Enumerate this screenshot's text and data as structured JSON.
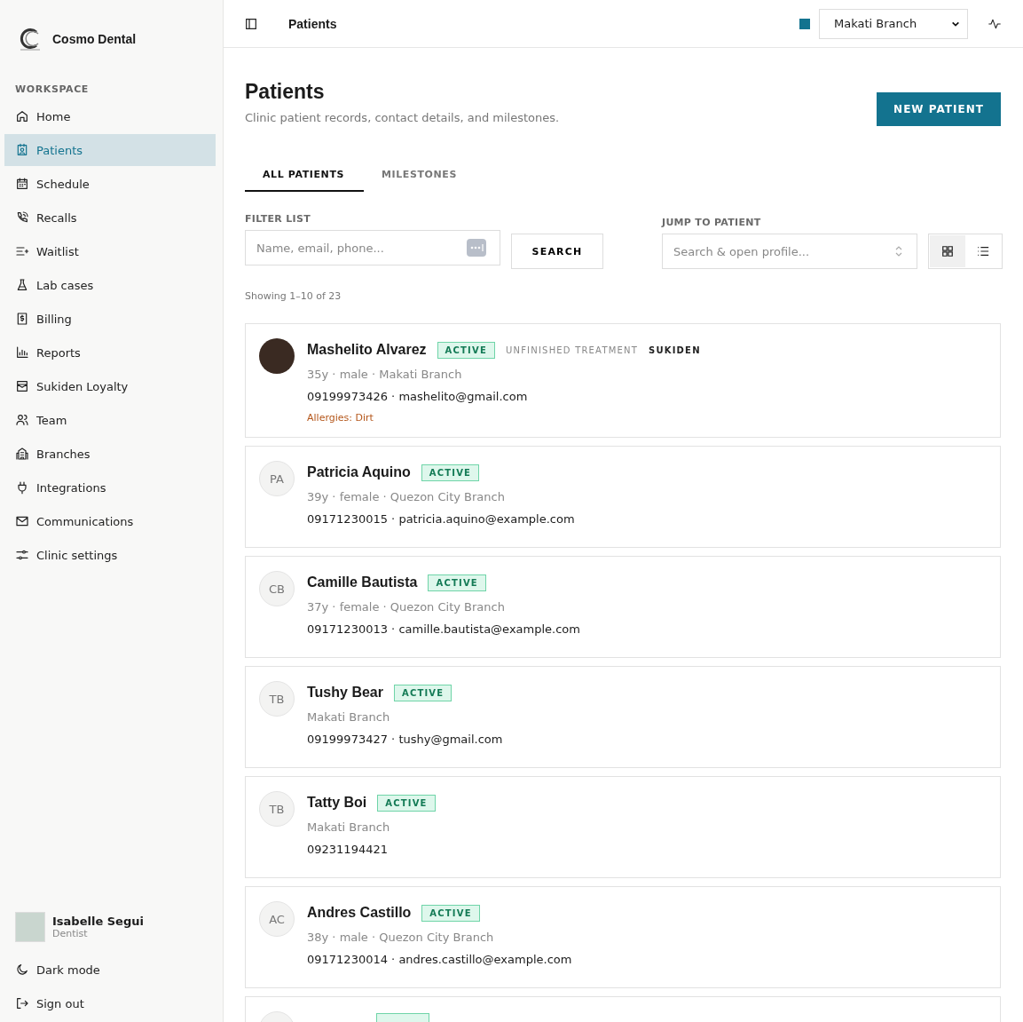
{
  "brand": {
    "name": "Cosmo Dental"
  },
  "sidebar": {
    "section": "WORKSPACE",
    "items": [
      {
        "label": "Home",
        "selected": false
      },
      {
        "label": "Patients",
        "selected": true
      },
      {
        "label": "Schedule",
        "selected": false
      },
      {
        "label": "Recalls",
        "selected": false
      },
      {
        "label": "Waitlist",
        "selected": false
      },
      {
        "label": "Lab cases",
        "selected": false
      },
      {
        "label": "Billing",
        "selected": false
      },
      {
        "label": "Reports",
        "selected": false
      },
      {
        "label": "Sukiden Loyalty",
        "selected": false
      },
      {
        "label": "Team",
        "selected": false
      },
      {
        "label": "Branches",
        "selected": false
      },
      {
        "label": "Integrations",
        "selected": false
      },
      {
        "label": "Communications",
        "selected": false
      },
      {
        "label": "Clinic settings",
        "selected": false
      }
    ],
    "user": {
      "name": "Isabelle Segui",
      "role": "Dentist"
    },
    "footer": [
      {
        "label": "Dark mode"
      },
      {
        "label": "Sign out"
      }
    ]
  },
  "topbar": {
    "title": "Patients",
    "branch": {
      "value": "Makati Branch",
      "color": "#13738f"
    }
  },
  "page": {
    "title": "Patients",
    "subtitle": "Clinic patient records, contact details, and milestones.",
    "action": "NEW PATIENT"
  },
  "tabs": [
    {
      "label": "ALL PATIENTS",
      "selected": true
    },
    {
      "label": "MILESTONES",
      "selected": false
    }
  ],
  "filter": {
    "label": "FILTER LIST",
    "placeholder": "Name, email, phone...",
    "button": "SEARCH"
  },
  "jump": {
    "label": "JUMP TO PATIENT",
    "placeholder": "Search & open profile..."
  },
  "view_toggle": [
    {
      "kind": "grid",
      "selected": true
    },
    {
      "kind": "list",
      "selected": false
    }
  ],
  "count": "Showing 1–10 of 23",
  "patients": [
    {
      "name": "Mashelito Alvarez",
      "status": "ACTIVE",
      "tags": [
        {
          "label": "UNFINISHED TREATMENT",
          "kind": "muted"
        },
        {
          "label": "SUKIDEN",
          "kind": "strong"
        }
      ],
      "details": "35y · male · Makati Branch",
      "contact": "09199973426 · mashelito@gmail.com",
      "allergies": "Allergies: Dirt"
    },
    {
      "name": "Patricia Aquino",
      "initials": "PA",
      "status": "ACTIVE",
      "details": "39y · female · Quezon City Branch",
      "contact": "09171230015 · patricia.aquino@example.com"
    },
    {
      "name": "Camille Bautista",
      "initials": "CB",
      "status": "ACTIVE",
      "details": "37y · female · Quezon City Branch",
      "contact": "09171230013 · camille.bautista@example.com"
    },
    {
      "name": "Tushy Bear",
      "initials": "TB",
      "status": "ACTIVE",
      "details": "Makati Branch",
      "contact": "09199973427 · tushy@gmail.com"
    },
    {
      "name": "Tatty Boi",
      "initials": "TB",
      "status": "ACTIVE",
      "details": "Makati Branch",
      "contact": "09231194421"
    },
    {
      "name": "Andres Castillo",
      "initials": "AC",
      "status": "ACTIVE",
      "details": "38y · male · Quezon City Branch",
      "contact": "09171230014 · andres.castillo@example.com"
    }
  ]
}
